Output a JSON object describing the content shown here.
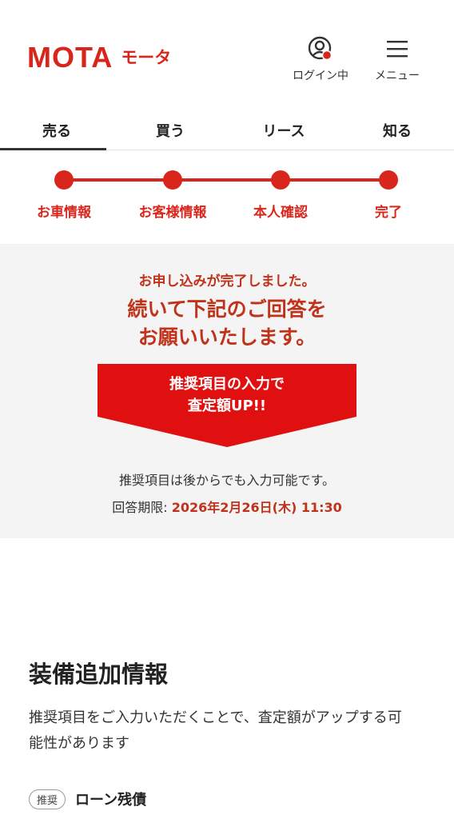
{
  "header": {
    "logo_text": "MOTA",
    "logo_kana": "モータ",
    "login_label": "ログイン中",
    "menu_label": "メニュー",
    "brand_color": "#d9261c",
    "icons": [
      "user-status-icon",
      "hamburger-menu-icon"
    ]
  },
  "tabs": [
    {
      "label": "売る",
      "active": true
    },
    {
      "label": "買う",
      "active": false
    },
    {
      "label": "リース",
      "active": false
    },
    {
      "label": "知る",
      "active": false
    }
  ],
  "progress": {
    "steps": [
      "お車情報",
      "お客様情報",
      "本人確認",
      "完了"
    ],
    "current_step": 4
  },
  "notice": {
    "small": "お申し込みが完了しました。",
    "big_line1": "続いて下記のご回答を",
    "big_line2": "お願いいたします。",
    "banner_line1": "推奨項目の入力で",
    "banner_line2": "査定額UP!!",
    "note": "推奨項目は後からでも入力可能です。",
    "deadline_label": "回答期限: ",
    "deadline_value": "2026年2月26日(木) 11:30"
  },
  "section": {
    "title": "装備追加情報",
    "desc": "推奨項目をご入力いただくことで、査定額がアップする可能性があります",
    "badge": "推奨",
    "item_label": "ローン残債"
  }
}
